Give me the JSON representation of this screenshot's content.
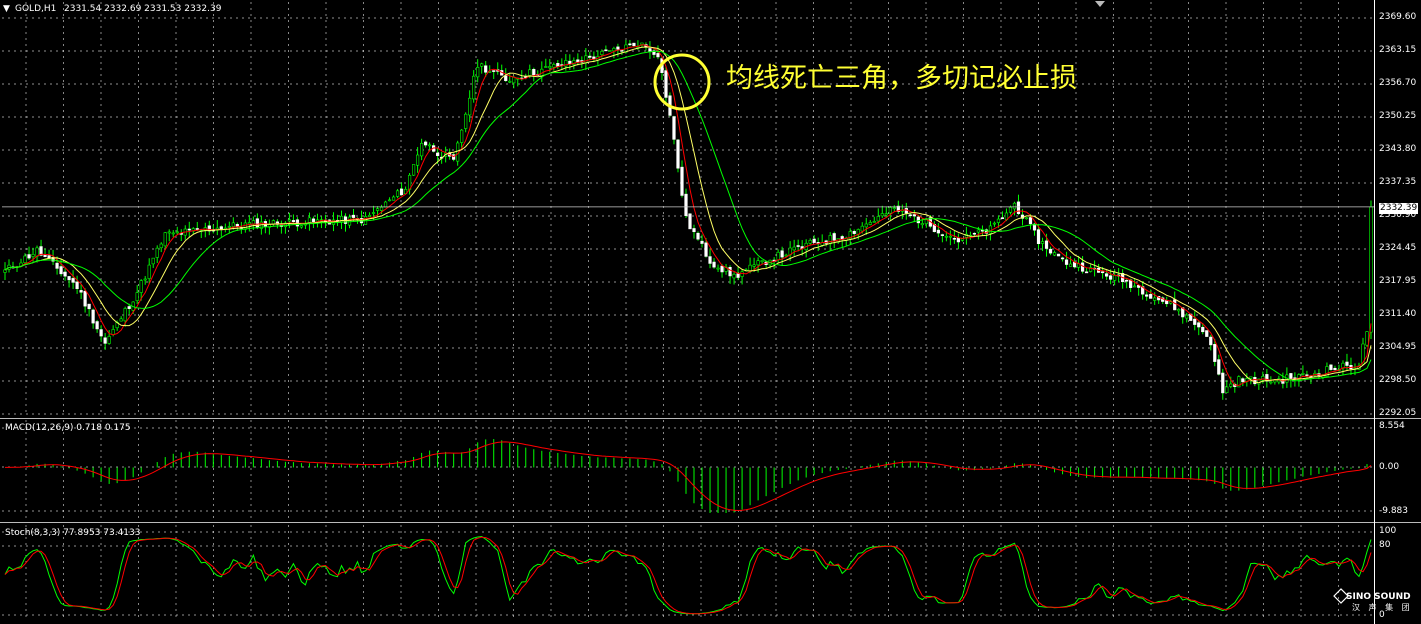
{
  "header": {
    "symbol_title": "GOLD,H1",
    "ohlc": "2331.54 2332.69 2331.53 2332.39",
    "menu_glyph": "▼"
  },
  "annotation": {
    "text": "均线死亡三角，多切记必止损",
    "color": "#FFFF33"
  },
  "price_panel": {
    "axis_labels": [
      "2369.60",
      "2363.15",
      "2356.70",
      "2350.25",
      "2343.80",
      "2337.35",
      "2330.90",
      "2324.45",
      "2317.95",
      "2311.40",
      "2304.95",
      "2298.50",
      "2292.05"
    ],
    "current_price": "2332.39"
  },
  "macd_panel": {
    "label": "MACD(12,26,9) 0.718 0.175",
    "axis_labels": [
      "8.554",
      "0.00",
      "-9.883"
    ]
  },
  "stoch_panel": {
    "label": "Stoch(8,3,3) 77.8953 73.4133",
    "axis_labels": [
      "100",
      "80",
      "0"
    ]
  },
  "logo": {
    "line1": "SINO SOUND",
    "line2": "汉 声 集 团"
  },
  "colors": {
    "background": "#000000",
    "grid": "#FFFFFF",
    "bull_candle": "#FFFFFF",
    "bear_candle": "#00FF00",
    "ma_fast": "#FF0000",
    "ma_mid": "#FFFF66",
    "ma_slow": "#00FF00",
    "macd_hist": "#00FF00",
    "macd_signal": "#FF0000",
    "stoch_main": "#00FF00",
    "stoch_signal": "#FF0000"
  },
  "chart_data": [
    {
      "type": "candlestick",
      "series_name": "GOLD,H1",
      "ylim": [
        2292.05,
        2369.6
      ],
      "price_anchors": [
        [
          0,
          2320
        ],
        [
          8,
          2324
        ],
        [
          18,
          2317
        ],
        [
          25,
          2306
        ],
        [
          33,
          2316
        ],
        [
          40,
          2327
        ],
        [
          60,
          2329
        ],
        [
          90,
          2330
        ],
        [
          100,
          2336
        ],
        [
          104,
          2345
        ],
        [
          112,
          2341
        ],
        [
          118,
          2360
        ],
        [
          125,
          2357
        ],
        [
          140,
          2360
        ],
        [
          150,
          2362
        ],
        [
          158,
          2364
        ],
        [
          163,
          2362
        ],
        [
          166,
          2350
        ],
        [
          170,
          2330
        ],
        [
          176,
          2322
        ],
        [
          182,
          2319
        ],
        [
          190,
          2322
        ],
        [
          200,
          2325
        ],
        [
          210,
          2327
        ],
        [
          222,
          2332
        ],
        [
          228,
          2330
        ],
        [
          238,
          2326
        ],
        [
          246,
          2328
        ],
        [
          252,
          2333
        ],
        [
          258,
          2326
        ],
        [
          264,
          2322
        ],
        [
          272,
          2320
        ],
        [
          280,
          2318
        ],
        [
          292,
          2313
        ],
        [
          300,
          2308
        ],
        [
          304,
          2297
        ],
        [
          308,
          2299
        ],
        [
          318,
          2299
        ],
        [
          326,
          2300
        ],
        [
          330,
          2301
        ],
        [
          338,
          2302
        ],
        [
          341,
          2312
        ]
      ],
      "last_close": 2332.39,
      "grid": true,
      "indicators": [
        "MA fast",
        "MA mid",
        "MA slow"
      ]
    },
    {
      "type": "histogram+line",
      "series_name": "MACD(12,26,9)",
      "values_latest": [
        0.718,
        0.175
      ],
      "ylim": [
        -9.883,
        8.554
      ]
    },
    {
      "type": "line",
      "series_name": "Stoch(8,3,3)",
      "values_latest": [
        77.8953,
        73.4133
      ],
      "ylim": [
        0,
        100
      ],
      "levels": [
        80
      ]
    }
  ]
}
